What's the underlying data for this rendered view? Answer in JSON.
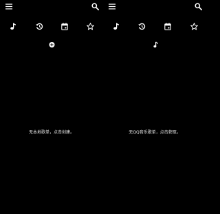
{
  "left_pane": {
    "toolbar": {
      "menu_icon": "menu-icon",
      "search_icon": "search-icon"
    },
    "tabs": [
      {
        "name": "tab-music",
        "icon": "music-note-icon"
      },
      {
        "name": "tab-history",
        "icon": "history-icon"
      },
      {
        "name": "tab-calendar",
        "icon": "calendar-icon"
      },
      {
        "name": "tab-favorites",
        "icon": "star-icon"
      }
    ],
    "section_icon": "add-circle-icon",
    "empty_message": "无本地歌单，点击创建。"
  },
  "right_pane": {
    "toolbar": {
      "menu_icon": "menu-icon",
      "search_icon": "search-icon"
    },
    "tabs": [
      {
        "name": "tab-music",
        "icon": "music-note-icon"
      },
      {
        "name": "tab-history",
        "icon": "history-icon"
      },
      {
        "name": "tab-calendar",
        "icon": "calendar-icon"
      },
      {
        "name": "tab-favorites",
        "icon": "star-icon"
      }
    ],
    "section_icon": "qq-music-icon",
    "empty_message": "无QQ音乐歌单，点击获取。"
  },
  "colors": {
    "background": "#000000",
    "foreground": "#ffffff",
    "message_text": "#e6e6e6"
  }
}
